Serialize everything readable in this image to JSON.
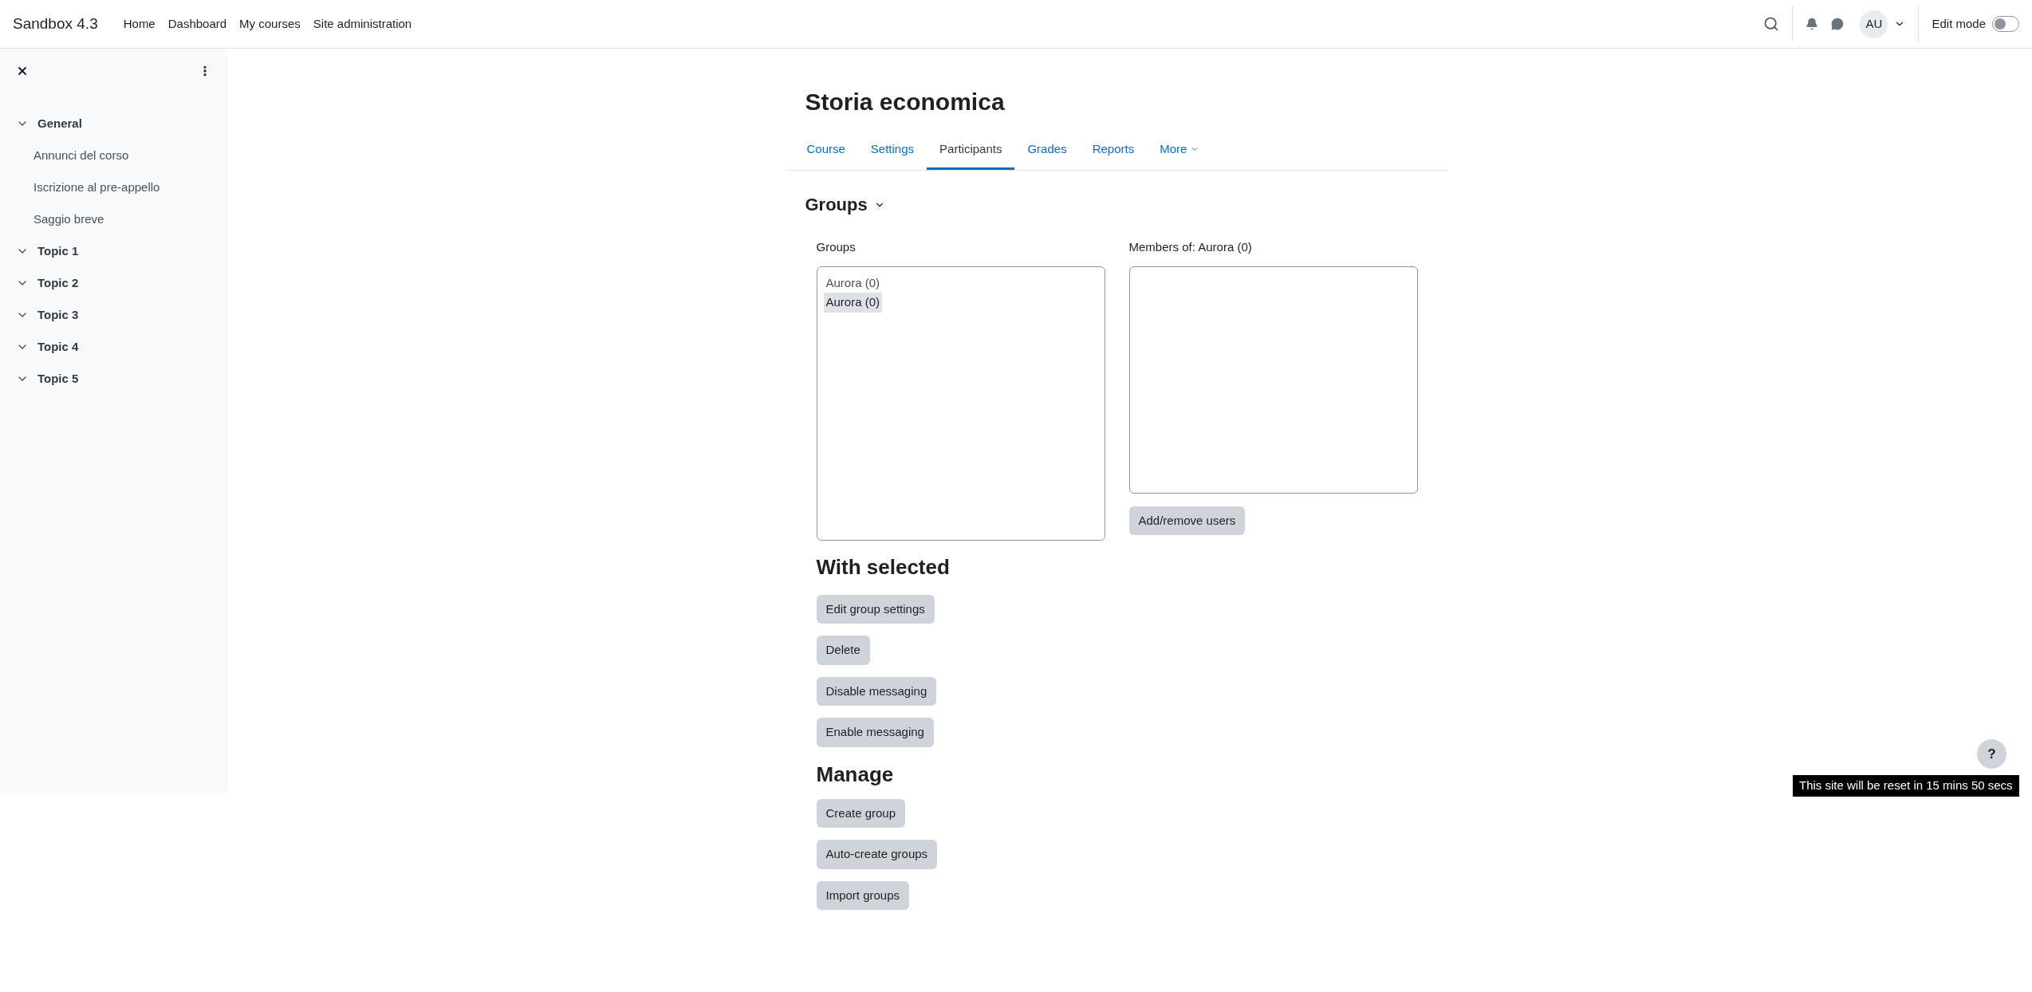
{
  "navbar": {
    "brand": "Sandbox 4.3",
    "links": [
      "Home",
      "Dashboard",
      "My courses",
      "Site administration"
    ],
    "avatar": "AU",
    "edit_mode": {
      "label": "Edit mode",
      "on": false
    }
  },
  "sidebar": {
    "sections": [
      {
        "title": "General",
        "expanded": true,
        "items": [
          "Annunci del corso",
          "Iscrizione al pre-appello",
          "Saggio breve"
        ]
      },
      {
        "title": "Topic 1",
        "expanded": true
      },
      {
        "title": "Topic 2",
        "expanded": true
      },
      {
        "title": "Topic 3",
        "expanded": true
      },
      {
        "title": "Topic 4",
        "expanded": true
      },
      {
        "title": "Topic 5",
        "expanded": true
      }
    ]
  },
  "page_title": "Storia economica",
  "tabs": [
    {
      "label": "Course",
      "selected": false,
      "kind": "link"
    },
    {
      "label": "Settings",
      "selected": false,
      "kind": "link"
    },
    {
      "label": "Participants",
      "selected": true,
      "kind": "link"
    },
    {
      "label": "Grades",
      "selected": false,
      "kind": "link"
    },
    {
      "label": "Reports",
      "selected": false,
      "kind": "link"
    },
    {
      "label": "More",
      "selected": false,
      "kind": "menu"
    }
  ],
  "section_title": "Groups",
  "groups_list": {
    "label": "Groups",
    "options": [
      {
        "label": "Aurora (0)",
        "selected": false
      },
      {
        "label": "Aurora (0)",
        "selected": true
      }
    ]
  },
  "members_list": {
    "label": "Members of: Aurora (0)",
    "button": "Add/remove users"
  },
  "with_selected": {
    "title": "With selected",
    "buttons": [
      "Edit group settings",
      "Delete",
      "Disable messaging",
      "Enable messaging"
    ]
  },
  "manage": {
    "title": "Manage",
    "buttons": [
      "Create group",
      "Auto-create groups",
      "Import groups"
    ]
  },
  "help_button": "?",
  "reset_notice": "This site will be reset in 15 mins 50 secs"
}
